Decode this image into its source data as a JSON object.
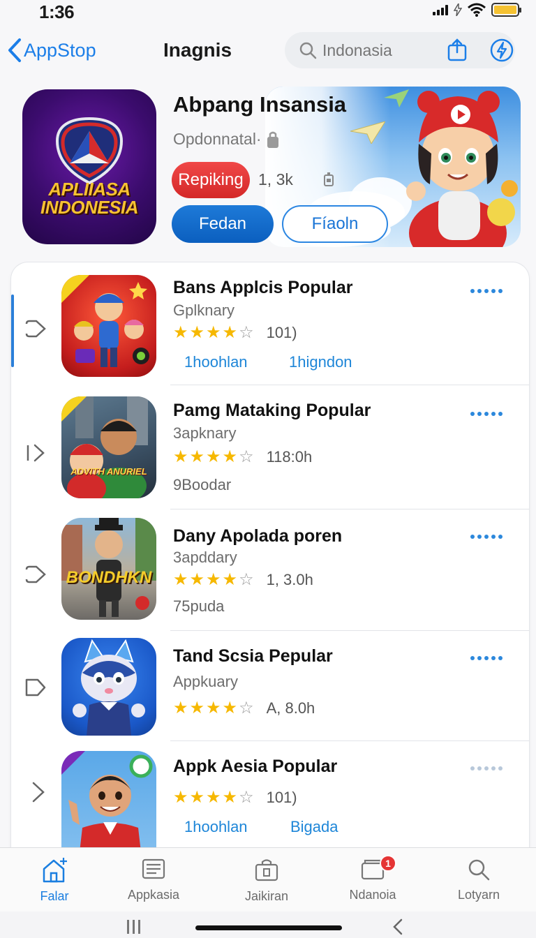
{
  "status_bar": {
    "time": "1:36"
  },
  "nav": {
    "back_label": "AppStop",
    "title": "Inagnis",
    "search_placeholder": "Indonasia"
  },
  "hero": {
    "icon_text_line1": "APLIIASA",
    "icon_text_line2": "INDONESIA",
    "title": "Abpang Insansia",
    "subtitle": "Opdonnatal·",
    "tag_label": "Repiking",
    "count": "1, 3k",
    "primary_button": "Fedan",
    "secondary_button": "Fíaoln"
  },
  "apps": [
    {
      "title": "Bans Applcis Popular",
      "category": "Gplknary",
      "rating": 4,
      "rating_count": "101)",
      "link1": "1hoohlan",
      "link2": "1higndon",
      "extra": ""
    },
    {
      "title": "Pamg Mataking Popular",
      "category": "3apknary",
      "rating": 4,
      "rating_count": "118:0h",
      "link1": "",
      "link2": "",
      "extra": "9Boodar",
      "icon_text": "ADVITH ANURIEL"
    },
    {
      "title": "Dany Apolada poren",
      "category": "3apddary",
      "rating": 4,
      "rating_count": "1, 3.0h",
      "link1": "",
      "link2": "",
      "extra": "75puda",
      "icon_text": "BONDHKN"
    },
    {
      "title": "Tand Scsia Pepular",
      "category": "Appkuary",
      "rating": 4,
      "rating_count": "A, 8.0h",
      "link1": "",
      "link2": "",
      "extra": ""
    },
    {
      "title": "Appk Aesia Popular",
      "category": "",
      "rating": 4,
      "rating_count": "101)",
      "link1": "1hoohlan",
      "link2": "Bigada",
      "extra": ""
    }
  ],
  "tabs": [
    {
      "label": "Falar",
      "icon": "home-icon",
      "active": true
    },
    {
      "label": "Appkasia",
      "icon": "list-icon"
    },
    {
      "label": "Jaikiran",
      "icon": "bag-icon"
    },
    {
      "label": "Ndanoia",
      "icon": "folder-icon",
      "badge": "1"
    },
    {
      "label": "Lotyarn",
      "icon": "search-icon"
    }
  ],
  "colors": {
    "accent": "#1b7ee8",
    "badge_red": "#e53535",
    "star": "#f6b800",
    "pill_red": "#e23636",
    "primary_blue": "#0b5fbf"
  }
}
